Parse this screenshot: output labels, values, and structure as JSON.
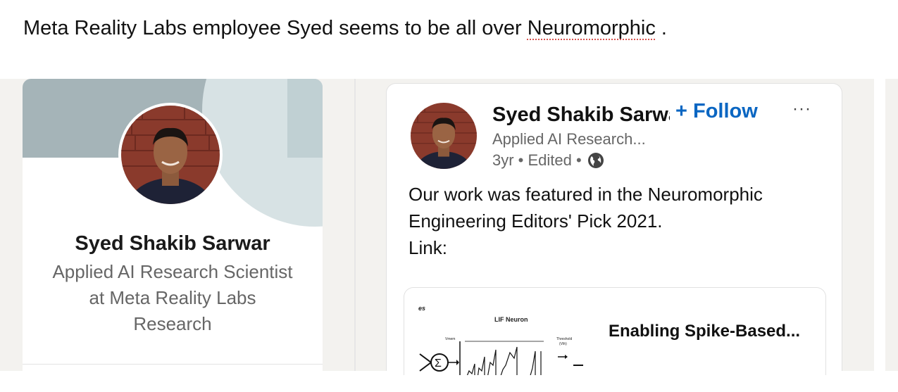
{
  "caption": {
    "before": "Meta Reality Labs employee Syed seems to be all over ",
    "highlight": "Neuromorphic",
    "after": " ."
  },
  "profile": {
    "name": "Syed Shakib Sarwar",
    "headline": "Applied AI Research Scientist at Meta Reality Labs Research"
  },
  "post": {
    "author_name": "Syed Shakib Sarwar",
    "follow_label": "+ Follow",
    "more_label": "···",
    "author_subtitle": "Applied AI Research...",
    "meta": "3yr • Edited •",
    "body": "Our work was featured in the Neuromorphic\nEngineering Editors' Pick 2021.\nLink:",
    "link_preview": {
      "title": "Enabling Spike-Based...",
      "thumb_corner": "es",
      "thumb_heading": "LIF Neuron",
      "thumb_threshold": "Threshold",
      "thumb_threshold_sym": "(Vth)",
      "thumb_input_sym": "Vmem"
    }
  },
  "colors": {
    "accent": "#0a66c2",
    "banner": "#a5b4b8",
    "muted_text": "#666666"
  }
}
